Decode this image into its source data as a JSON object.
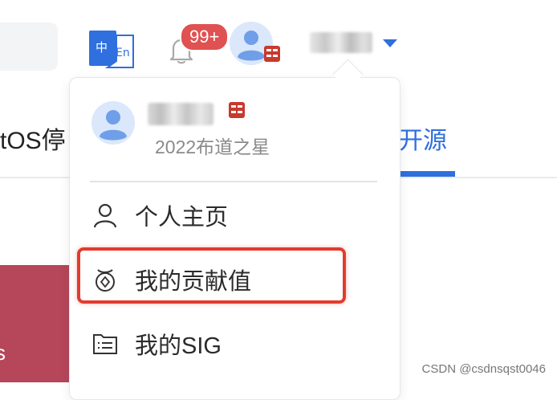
{
  "header": {
    "notification_count": "99+",
    "icons": [
      "translate-icon",
      "bell-icon",
      "avatar",
      "chevron-down-icon"
    ],
    "lang_icon_chars": [
      "中",
      "En"
    ]
  },
  "background": {
    "nav_text": "tOS停",
    "tab_text": "开源",
    "banner_text": "s",
    "colors": {
      "accent": "#2f6fde",
      "banner": "#b6465a"
    }
  },
  "dropdown": {
    "subtitle": "2022布道之星",
    "items": [
      {
        "label": "个人主页",
        "icon": "user-icon"
      },
      {
        "label": "我的贡献值",
        "icon": "coin-icon"
      },
      {
        "label": "我的SIG",
        "icon": "folder-list-icon"
      }
    ],
    "highlight_color": "#e23b2e"
  },
  "watermark": "CSDN @csdnsqst0046"
}
